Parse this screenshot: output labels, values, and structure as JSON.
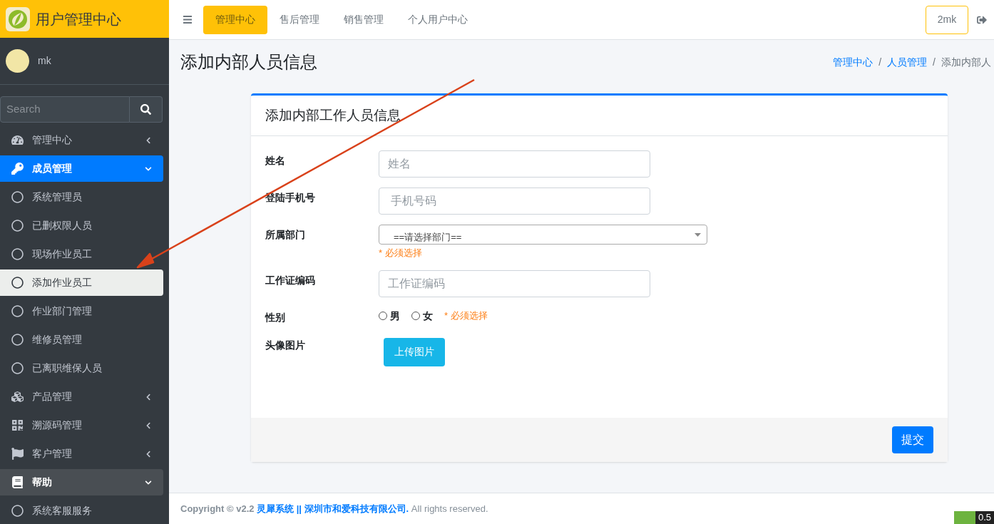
{
  "brand": {
    "title": "用户管理中心"
  },
  "user": {
    "name": "mk"
  },
  "search": {
    "placeholder": "Search"
  },
  "nav": [
    {
      "label": "管理中心",
      "selected": false,
      "expanded": false
    },
    {
      "label": "成员管理",
      "selected": true,
      "expanded": true,
      "children": [
        {
          "label": "系统管理员",
          "selected": false
        },
        {
          "label": "已删权限人员",
          "selected": false
        },
        {
          "label": "现场作业员工",
          "selected": false
        },
        {
          "label": "添加作业员工",
          "selected": true
        },
        {
          "label": "作业部门管理",
          "selected": false
        },
        {
          "label": "维修员管理",
          "selected": false
        },
        {
          "label": "已离职维保人员",
          "selected": false
        }
      ]
    },
    {
      "label": "产品管理",
      "selected": false,
      "expanded": false
    },
    {
      "label": "溯源码管理",
      "selected": false,
      "expanded": false
    },
    {
      "label": "客户管理",
      "selected": false,
      "expanded": false
    },
    {
      "label": "帮助",
      "selected": false,
      "expanded": true,
      "children": [
        {
          "label": "系统客服服务",
          "selected": false
        }
      ]
    }
  ],
  "topnav": [
    {
      "label": "管理中心",
      "selected": true
    },
    {
      "label": "售后管理",
      "selected": false
    },
    {
      "label": "销售管理",
      "selected": false
    },
    {
      "label": "个人用户中心",
      "selected": false
    }
  ],
  "account_button": "2mk",
  "page_title": "添加内部人员信息",
  "breadcrumb": [
    {
      "label": "管理中心",
      "link": true
    },
    {
      "label": "/",
      "link": false
    },
    {
      "label": "人员管理",
      "link": true
    },
    {
      "label": "/",
      "link": false
    },
    {
      "label": "添加内部人",
      "link": false
    }
  ],
  "card": {
    "title": "添加内部工作人员信息",
    "fields": [
      {
        "kind": "text",
        "label": "姓名",
        "placeholder": "姓名"
      },
      {
        "kind": "text",
        "label": "登陆手机号",
        "placeholder": " 手机号码"
      },
      {
        "kind": "select",
        "label": "所属部门",
        "value": "==请选择部门==",
        "note": "* 必须选择"
      },
      {
        "kind": "text",
        "label": "工作证编码",
        "placeholder": "工作证编码"
      },
      {
        "kind": "radio",
        "label": "性别",
        "options": [
          {
            "label": "男",
            "selected": false
          },
          {
            "label": "女",
            "selected": false
          }
        ],
        "note": "* 必须选择"
      },
      {
        "kind": "upload",
        "label": "头像图片",
        "button": "上传图片"
      }
    ],
    "submit": "提交"
  },
  "footer": {
    "text": "**Copyright © v2.2** **灵犀系统 || 深圳市和爱科技有限公司.** All rights reserved."
  },
  "widget": {
    "text": "0.5"
  }
}
